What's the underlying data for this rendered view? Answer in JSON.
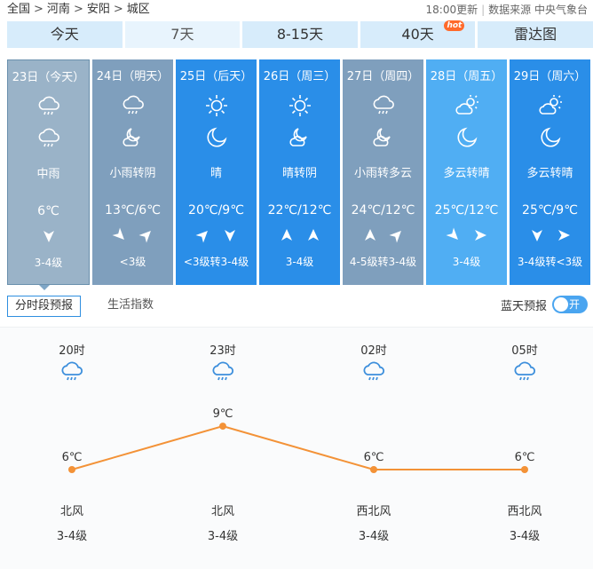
{
  "breadcrumb": [
    "全国",
    "河南",
    "安阳",
    "城区"
  ],
  "breadcrumb_sep": ">",
  "update_time": "18:00更新",
  "source_label": "数据来源 中央气象台",
  "tabs": [
    {
      "label": "今天"
    },
    {
      "label": "7天"
    },
    {
      "label": "8-15天"
    },
    {
      "label": "40天",
      "badge": "hot"
    },
    {
      "label": "雷达图"
    }
  ],
  "days": [
    {
      "date": "23日（今天）",
      "icon_day": "rain-cloud-icon",
      "icon_night": "rain-cloud-icon",
      "desc": "中雨",
      "temp": "6℃",
      "wind_dirs": [
        "south"
      ],
      "level": "3-4级",
      "bg": "#9ab3c8"
    },
    {
      "date": "24日（明天）",
      "icon_day": "rain-cloud-icon",
      "icon_night": "cloudy-night-icon",
      "desc": "小雨转阴",
      "temp": "13℃/6℃",
      "wind_dirs": [
        "southeast",
        "northeast"
      ],
      "level": "<3级",
      "bg": "#7f9fbd"
    },
    {
      "date": "25日（后天）",
      "icon_day": "sun-icon",
      "icon_night": "moon-icon",
      "desc": "晴",
      "temp": "20℃/9℃",
      "wind_dirs": [
        "northeast",
        "south"
      ],
      "level": "<3级转3-4级",
      "bg": "#2a8ee8"
    },
    {
      "date": "26日（周三）",
      "icon_day": "sun-icon",
      "icon_night": "cloudy-night-icon",
      "desc": "晴转阴",
      "temp": "22℃/12℃",
      "wind_dirs": [
        "north",
        "north"
      ],
      "level": "3-4级",
      "bg": "#2a8ee8"
    },
    {
      "date": "27日（周四）",
      "icon_day": "rain-cloud-icon",
      "icon_night": "cloudy-night-icon",
      "desc": "小雨转多云",
      "temp": "24℃/12℃",
      "wind_dirs": [
        "north",
        "northeast"
      ],
      "level": "4-5级转3-4级",
      "bg": "#7f9fbd"
    },
    {
      "date": "28日（周五）",
      "icon_day": "partly-cloudy-icon",
      "icon_night": "moon-icon",
      "desc": "多云转晴",
      "temp": "25℃/12℃",
      "wind_dirs": [
        "southeast",
        "east"
      ],
      "level": "3-4级",
      "bg": "#50aef3"
    },
    {
      "date": "29日（周六）",
      "icon_day": "partly-cloudy-icon",
      "icon_night": "moon-icon",
      "desc": "多云转晴",
      "temp": "25℃/9℃",
      "wind_dirs": [
        "south",
        "east"
      ],
      "level": "3-4级转<3级",
      "bg": "#2a8ee8"
    }
  ],
  "subtabs": [
    {
      "label": "分时段预报",
      "active": true
    },
    {
      "label": "生活指数",
      "active": false
    }
  ],
  "bluesky": {
    "label": "蓝天预报",
    "toggle": "开"
  },
  "hourly": [
    {
      "time": "20时",
      "icon": "rain-icon",
      "temp": 6,
      "temp_label": "6℃",
      "wind": "北风",
      "level": "3-4级"
    },
    {
      "time": "23时",
      "icon": "rain-icon",
      "temp": 9,
      "temp_label": "9℃",
      "wind": "北风",
      "level": "3-4级"
    },
    {
      "time": "02时",
      "icon": "rain-icon",
      "temp": 6,
      "temp_label": "6℃",
      "wind": "西北风",
      "level": "3-4级"
    },
    {
      "time": "05时",
      "icon": "rain-icon",
      "temp": 6,
      "temp_label": "6℃",
      "wind": "西北风",
      "level": "3-4级"
    }
  ],
  "colors": {
    "line": "#f39237",
    "tab_bg": "#d7ecfb",
    "accent": "#2f8fe0"
  }
}
